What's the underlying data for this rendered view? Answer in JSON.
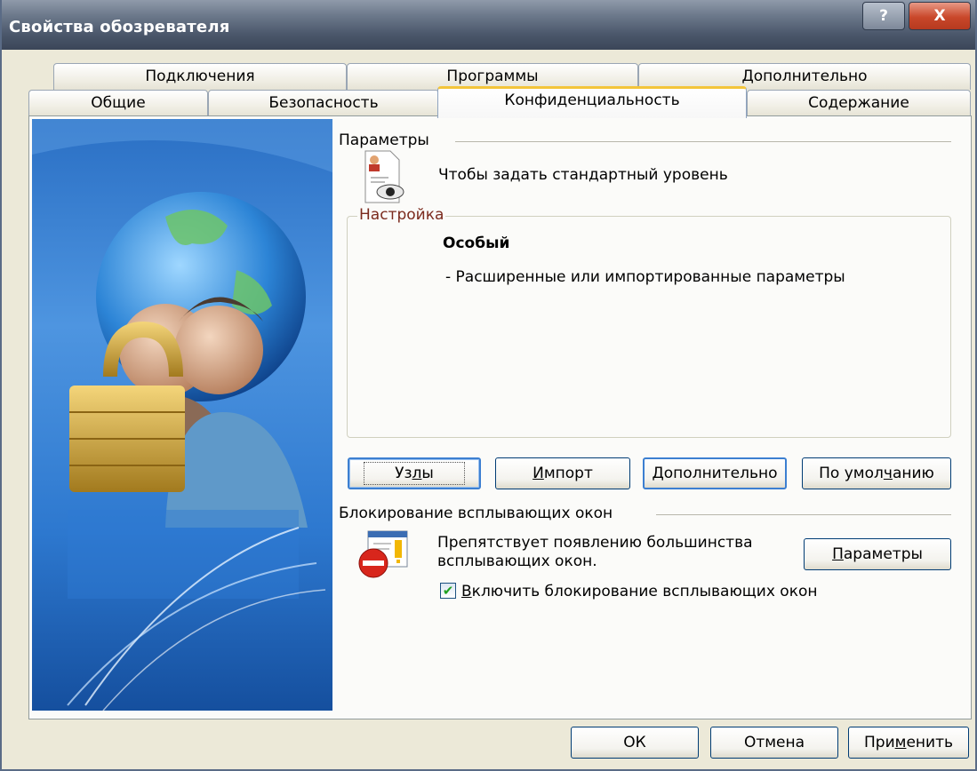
{
  "window": {
    "title": "Свойства обозревателя",
    "help_label": "?",
    "close_label": "X"
  },
  "tabs": {
    "row1": [
      {
        "label": "Подключения"
      },
      {
        "label": "Программы"
      },
      {
        "label": "Дополнительно"
      }
    ],
    "row2": [
      {
        "label": "Общие"
      },
      {
        "label": "Безопасность"
      },
      {
        "label": "Конфиденциальность",
        "active": true
      },
      {
        "label": "Содержание"
      }
    ]
  },
  "privacy": {
    "params_label": "Параметры",
    "params_description": "Чтобы задать стандартный уровень",
    "settings_label": "Настройка",
    "level_name": "Особый",
    "level_description": "- Расширенные или импортированные параметры"
  },
  "buttons": {
    "sites": {
      "pre": "Уз",
      "key": "л",
      "post": "ы"
    },
    "import": {
      "pre": "",
      "key": "И",
      "post": "мпорт"
    },
    "advanced": {
      "pre": "",
      "key": "Д",
      "post": "ополнительно"
    },
    "default": {
      "pre": "По умол",
      "key": "ч",
      "post": "анию"
    }
  },
  "popup": {
    "group_label": "Блокирование всплывающих окон",
    "description_line1": "Препятствует появлению большинства",
    "description_line2": "всплывающих окон.",
    "settings_button": {
      "pre": "",
      "key": "П",
      "post": "араметры"
    },
    "checkbox_checked": true,
    "checkbox_label": {
      "pre": "",
      "key": "В",
      "post": "ключить блокирование всплывающих окон"
    }
  },
  "footer": {
    "ok": "ОК",
    "cancel": "Отмена",
    "apply": {
      "pre": "При",
      "key": "м",
      "post": "енить"
    }
  },
  "colors": {
    "title_bar": "#4a566a",
    "close_button": "#c9472a",
    "dialog_bg": "#ece9d8",
    "accent_focus": "#3c7fd1",
    "legend_text": "#7b2a1d"
  }
}
